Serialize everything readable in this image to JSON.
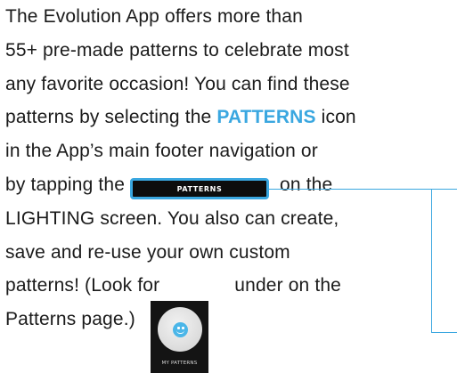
{
  "paragraph": {
    "line1": "The Evolution App offers more than",
    "line2": "55+ pre-made patterns to celebrate most",
    "line3": "any favorite occasion! You can find these",
    "line4_pre": "patterns by selecting the ",
    "line4_accent": "PATTERNS",
    "line4_post": " icon",
    "line5": "in the App’s main footer navigation or",
    "line6_pre": "by tapping the",
    "line6_post": "on the",
    "line7": "LIGHTING screen. You also can create,",
    "line8": "save and re-use your own custom",
    "line9_pre": "patterns! (Look for",
    "line9_post": "under on the",
    "line10": "Patterns page.)"
  },
  "patterns_button": {
    "label": "PATTERNS"
  },
  "my_patterns_icon": {
    "label": "MY PATTERNS",
    "icon": "smiley-face-icon"
  },
  "colors": {
    "accent": "#3aa7e0",
    "text": "#1b1b1b",
    "button_bg": "#0d0d0d"
  }
}
